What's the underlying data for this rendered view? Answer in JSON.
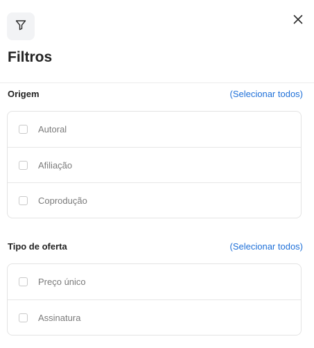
{
  "header": {
    "filter_icon": "filter-icon",
    "close_icon": "close-icon",
    "title": "Filtros"
  },
  "sections": [
    {
      "title": "Origem",
      "select_all": "(Selecionar todos)",
      "options": [
        {
          "label": "Autoral",
          "checked": false
        },
        {
          "label": "Afiliação",
          "checked": false
        },
        {
          "label": "Coprodução",
          "checked": false
        }
      ]
    },
    {
      "title": "Tipo de oferta",
      "select_all": "(Selecionar todos)",
      "options": [
        {
          "label": "Preço único",
          "checked": false
        },
        {
          "label": "Assinatura",
          "checked": false
        }
      ]
    }
  ],
  "colors": {
    "link": "#1d6fd8",
    "icon_bg": "#f2f3f5",
    "border": "#e3e3e3"
  }
}
